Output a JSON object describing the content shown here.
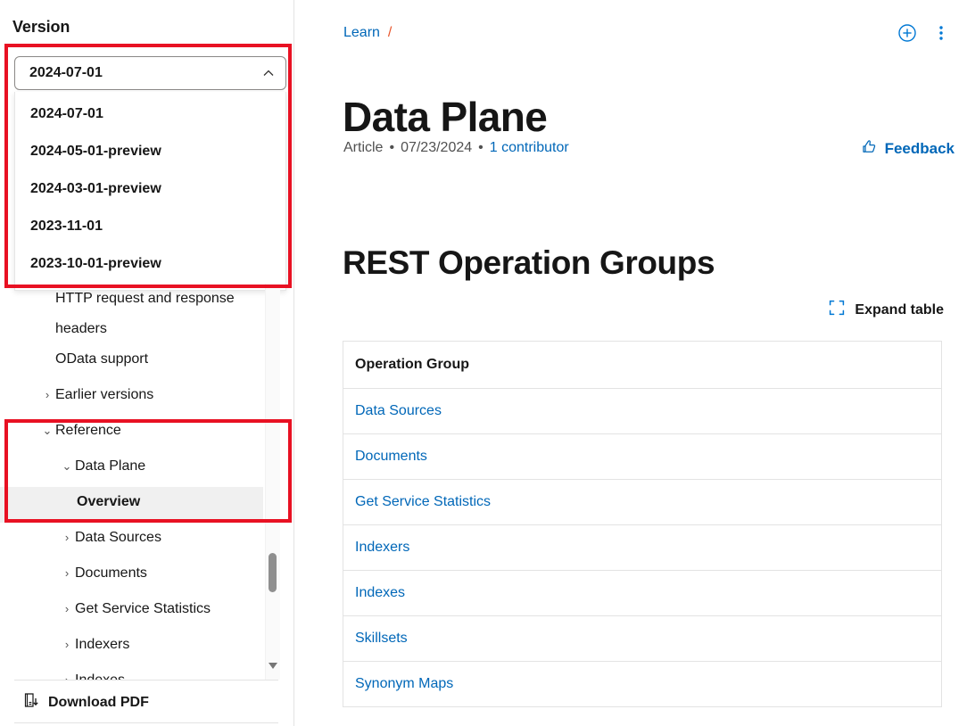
{
  "sidebar": {
    "version_label": "Version",
    "combobox": {
      "selected": "2024-07-01",
      "chevron_icon": "chevron-up-icon",
      "expanded": true,
      "options": [
        "2024-07-01",
        "2024-05-01-preview",
        "2024-03-01-preview",
        "2023-11-01",
        "2023-10-01-preview"
      ]
    },
    "nav_items": [
      {
        "label": "HTTP request and response headers",
        "level": 1,
        "twisty": "",
        "selected": false,
        "wrap": true
      },
      {
        "label": "OData support",
        "level": 1,
        "twisty": "",
        "selected": false,
        "wrap": false
      },
      {
        "label": "Earlier versions",
        "level": 1,
        "twisty": "›",
        "selected": false,
        "wrap": false
      },
      {
        "label": "Reference",
        "level": 1,
        "twisty": "⌄",
        "selected": false,
        "wrap": false
      },
      {
        "label": "Data Plane",
        "level": 2,
        "twisty": "⌄",
        "selected": false,
        "wrap": false
      },
      {
        "label": "Overview",
        "level": 3,
        "twisty": "",
        "selected": true,
        "wrap": false
      },
      {
        "label": "Data Sources",
        "level": 2,
        "twisty": "›",
        "selected": false,
        "wrap": false
      },
      {
        "label": "Documents",
        "level": 2,
        "twisty": "›",
        "selected": false,
        "wrap": false
      },
      {
        "label": "Get Service Statistics",
        "level": 2,
        "twisty": "›",
        "selected": false,
        "wrap": false
      },
      {
        "label": "Indexers",
        "level": 2,
        "twisty": "›",
        "selected": false,
        "wrap": false
      },
      {
        "label": "Indexes",
        "level": 2,
        "twisty": "›",
        "selected": false,
        "wrap": false
      }
    ],
    "download_pdf": {
      "label": "Download PDF",
      "icon": "download-pdf-icon"
    },
    "scrollbar": {
      "thumb_name": "scrollbar-thumb",
      "down_arrow_name": "scrollbar-down-arrow"
    }
  },
  "annotations": {
    "version_highlight": "red-highlight-version-dropdown",
    "reference_highlight": "red-highlight-reference-nav",
    "color": "#e81123"
  },
  "main": {
    "breadcrumb": {
      "items": [
        "Learn"
      ],
      "separator": "/"
    },
    "header_actions": [
      {
        "name": "add-to-collection-icon",
        "label": ""
      },
      {
        "name": "more-options-icon",
        "label": ""
      }
    ],
    "title": "Data Plane",
    "meta": {
      "type": "Article",
      "separator": "•",
      "date": "07/23/2024",
      "contributors": "1 contributor"
    },
    "feedback": {
      "label": "Feedback",
      "icon": "thumbs-up-icon"
    },
    "section_heading": "REST Operation Groups",
    "expand_table": {
      "label": "Expand table",
      "icon": "expand-table-icon"
    },
    "table": {
      "columns": [
        "Operation Group"
      ],
      "rows": [
        [
          "Data Sources"
        ],
        [
          "Documents"
        ],
        [
          "Get Service Statistics"
        ],
        [
          "Indexers"
        ],
        [
          "Indexes"
        ],
        [
          "Skillsets"
        ],
        [
          "Synonym Maps"
        ]
      ]
    }
  },
  "colors": {
    "link": "#0067b8",
    "text": "#161616",
    "muted": "#505050",
    "border": "#e3e3e3",
    "selected_bg": "#f0f0f0",
    "annotation_red": "#e81123"
  }
}
